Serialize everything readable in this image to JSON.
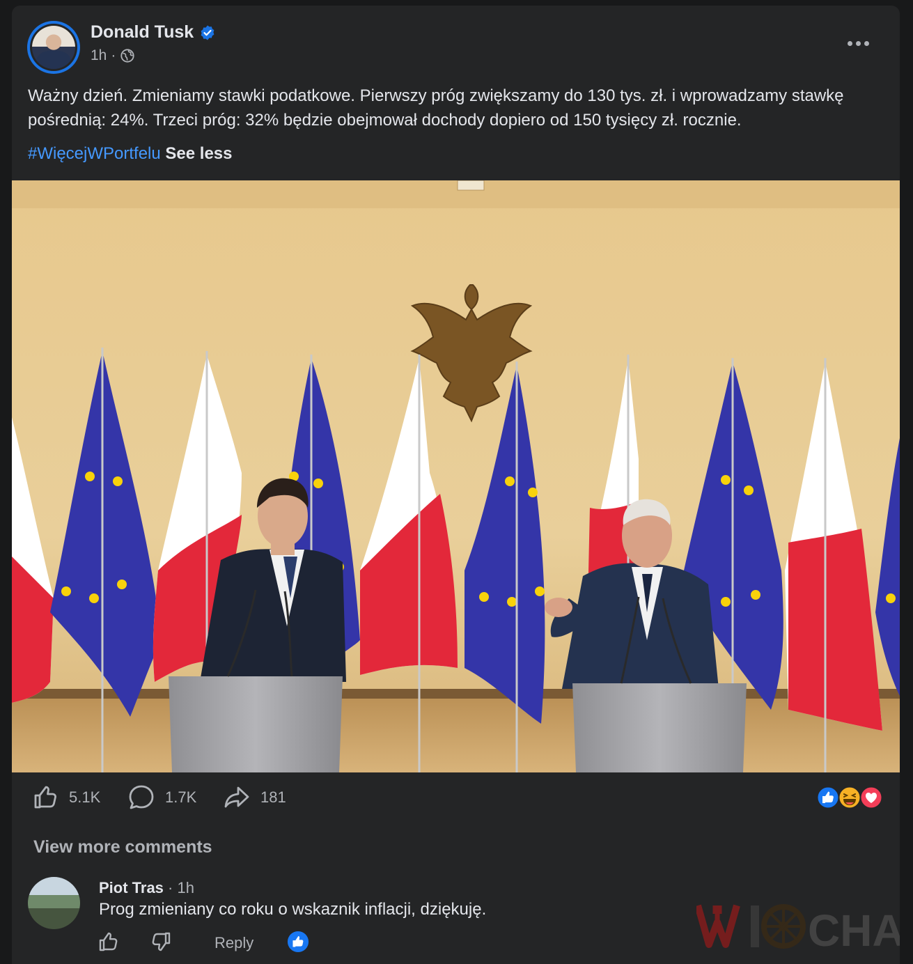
{
  "post": {
    "author": "Donald Tusk",
    "time": "1h",
    "separator": "·",
    "text": "Ważny dzień. Zmieniamy stawki podatkowe. Pierwszy próg zwiększamy do 130 tys. zł. i wprowadzamy stawkę pośrednią: 24%. Trzeci próg: 32% będzie obejmował dochody dopiero od 150 tysięcy zł. rocznie.",
    "hashtag": "#WięcejWPortfelu",
    "see_less": "See less",
    "image_icon": "press-conference-photo"
  },
  "actions": {
    "likes": "5.1K",
    "comments": "1.7K",
    "shares": "181",
    "reaction_icons": [
      "like-reaction-icon",
      "haha-reaction-icon",
      "love-reaction-icon"
    ]
  },
  "comments": {
    "view_more": "View more comments",
    "items": [
      {
        "author": "Piot Tras",
        "time": "· 1h",
        "text": "Prog zmieniany co roku o wskaznik inflacji, dziękuję.",
        "reply_label": "Reply"
      }
    ]
  },
  "watermark": {
    "text": "WIOCHA"
  },
  "colors": {
    "background": "#18191a",
    "card": "#242526",
    "link": "#4599ff",
    "verified": "#1b74e4",
    "secondary_text": "#b0b3b8"
  }
}
